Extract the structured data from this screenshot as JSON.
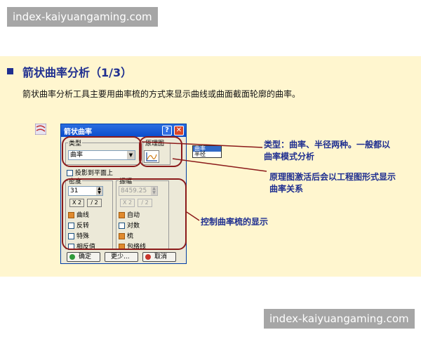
{
  "watermarks": {
    "top": "index-kaiyuangaming.com",
    "bottom": "index-kaiyuangaming.com"
  },
  "slide": {
    "title": "箭状曲率分析（1/3）",
    "description": "箭状曲率分析工具主要用曲率梳的方式来显示曲线或曲面截面轮廓的曲率。"
  },
  "dialog": {
    "title": "箭状曲率",
    "help_label": "?",
    "close_label": "✕",
    "type_group": {
      "label": "类型",
      "selected": "曲率"
    },
    "diagram_group": {
      "label": "原理图"
    },
    "project_plane_label": "投影到平面上",
    "density_group": {
      "label": "密度",
      "value": "31",
      "btn_x2": "X 2",
      "btn_div2": "/ 2",
      "options": [
        {
          "label": "曲线",
          "checked": true
        },
        {
          "label": "反转",
          "checked": false
        },
        {
          "label": "特殊",
          "checked": false
        },
        {
          "label": "相反值",
          "checked": false
        }
      ]
    },
    "amplitude_group": {
      "label": "振幅",
      "value": "8459.25",
      "btn_x2": "X 2",
      "btn_div2": "/ 2",
      "options": [
        {
          "label": "自动",
          "checked": true
        },
        {
          "label": "对数",
          "checked": false
        },
        {
          "label": "梳",
          "checked": true
        },
        {
          "label": "包络线",
          "checked": true
        }
      ]
    },
    "ok_label": "确定",
    "more_label": "更少...",
    "cancel_label": "取消"
  },
  "dropdown_popup": {
    "items": [
      "曲率",
      "半径"
    ],
    "selected": "曲率"
  },
  "annotations": {
    "type_note": [
      "类型：曲率、半径两种。一般都以",
      "曲率模式分析"
    ],
    "diagram_note": [
      "原理图激活后会以工程图形式显示",
      "曲率关系"
    ],
    "control_note": "控制曲率梳的显示"
  },
  "colors": {
    "slide_bg": "#fff6cf",
    "title_blue": "#1f2f90",
    "highlight_red": "#8b1a1a"
  }
}
